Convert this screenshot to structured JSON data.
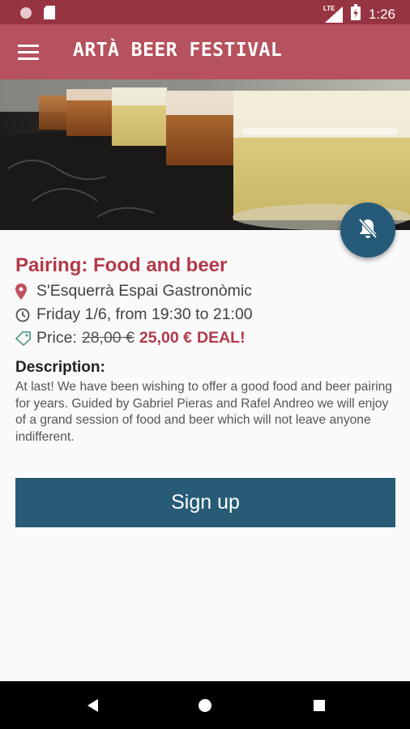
{
  "status_bar": {
    "time": "1:26",
    "network": "LTE",
    "icons": [
      "circle-notification-icon",
      "sd-card-icon",
      "signal-icon",
      "battery-charging-icon"
    ]
  },
  "app_bar": {
    "title": "ARTÀ BEER FESTIVAL",
    "menu_icon": "hamburger-menu-icon"
  },
  "event": {
    "title": "Pairing: Food and beer",
    "location": "S'Esquerrà Espai Gastronòmic",
    "datetime": "Friday 1/6, from 19:30 to 21:00",
    "price_label": "Price:",
    "old_price": "28,00 €",
    "new_price": "25,00 €",
    "deal_label": "DEAL!",
    "description_heading": "Description:",
    "description": "At last! We have been wishing to offer a good food and beer pairing for years. Guided by Gabriel Pieras and Rafel Andreo we will enjoy of a grand session of food and beer which will not leave anyone indifferent."
  },
  "signup_button": "Sign up",
  "colors": {
    "status_bar": "#963442",
    "app_bar": "#b6515e",
    "accent_red": "#b23a4a",
    "button_blue": "#275b76",
    "fab_blue": "#255b78"
  },
  "navigation": [
    "back-icon",
    "home-icon",
    "recents-icon"
  ]
}
